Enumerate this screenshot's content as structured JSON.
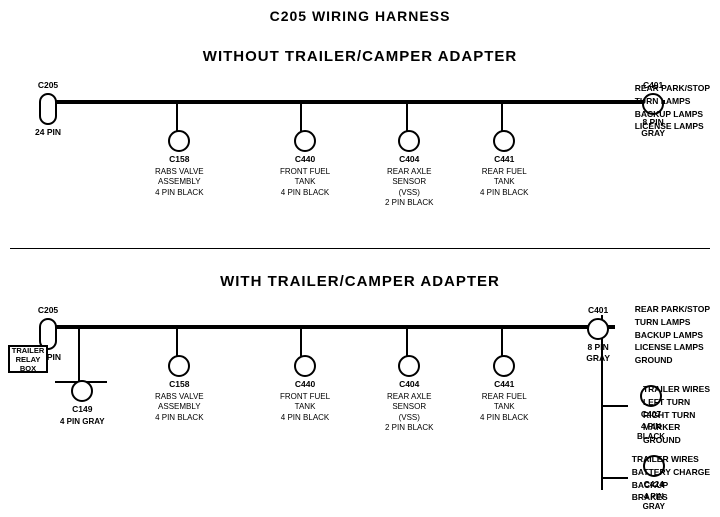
{
  "title": "C205 WIRING HARNESS",
  "divider": true,
  "top": {
    "section_label": "WITHOUT  TRAILER/CAMPER  ADAPTER",
    "c205": {
      "id": "C205",
      "sub": "24 PIN"
    },
    "c401": {
      "id": "C401",
      "sub": "8 PIN\nGRAY",
      "right_labels": [
        "REAR PARK/STOP",
        "TURN LAMPS",
        "BACKUP LAMPS",
        "LICENSE LAMPS"
      ]
    },
    "connectors": [
      {
        "id": "C158",
        "sub": "RABS VALVE\nASSEMBLY\n4 PIN BLACK"
      },
      {
        "id": "C440",
        "sub": "FRONT FUEL\nTANK\n4 PIN BLACK"
      },
      {
        "id": "C404",
        "sub": "REAR AXLE\nSENSOR\n(VSS)\n2 PIN BLACK"
      },
      {
        "id": "C441",
        "sub": "REAR FUEL\nTANK\n4 PIN BLACK"
      }
    ]
  },
  "bottom": {
    "section_label": "WITH  TRAILER/CAMPER  ADAPTER",
    "c205": {
      "id": "C205",
      "sub": "24 PIN"
    },
    "c401": {
      "id": "C401",
      "sub": "8 PIN\nGRAY",
      "right_labels": [
        "REAR PARK/STOP",
        "TURN LAMPS",
        "BACKUP LAMPS",
        "LICENSE LAMPS",
        "GROUND"
      ]
    },
    "trailer_relay": {
      "label": "TRAILER\nRELAY\nBOX"
    },
    "c149": {
      "id": "C149",
      "sub": "4 PIN GRAY"
    },
    "connectors": [
      {
        "id": "C158",
        "sub": "RABS VALVE\nASSEMBLY\n4 PIN BLACK"
      },
      {
        "id": "C440",
        "sub": "FRONT FUEL\nTANK\n4 PIN BLACK"
      },
      {
        "id": "C404",
        "sub": "REAR AXLE\nSENSOR\n(VSS)\n2 PIN BLACK"
      },
      {
        "id": "C441",
        "sub": "REAR FUEL\nTANK\n4 PIN BLACK"
      }
    ],
    "c407": {
      "id": "C407",
      "sub": "4 PIN\nBLACK",
      "right_labels": [
        "TRAILER WIRES",
        "LEFT TURN",
        "RIGHT TURN",
        "MARKER",
        "GROUND"
      ]
    },
    "c424": {
      "id": "C424",
      "sub": "4 PIN\nGRAY",
      "right_labels": [
        "TRAILER WIRES",
        "BATTERY CHARGE",
        "BACKUP",
        "BRAKES"
      ]
    }
  }
}
